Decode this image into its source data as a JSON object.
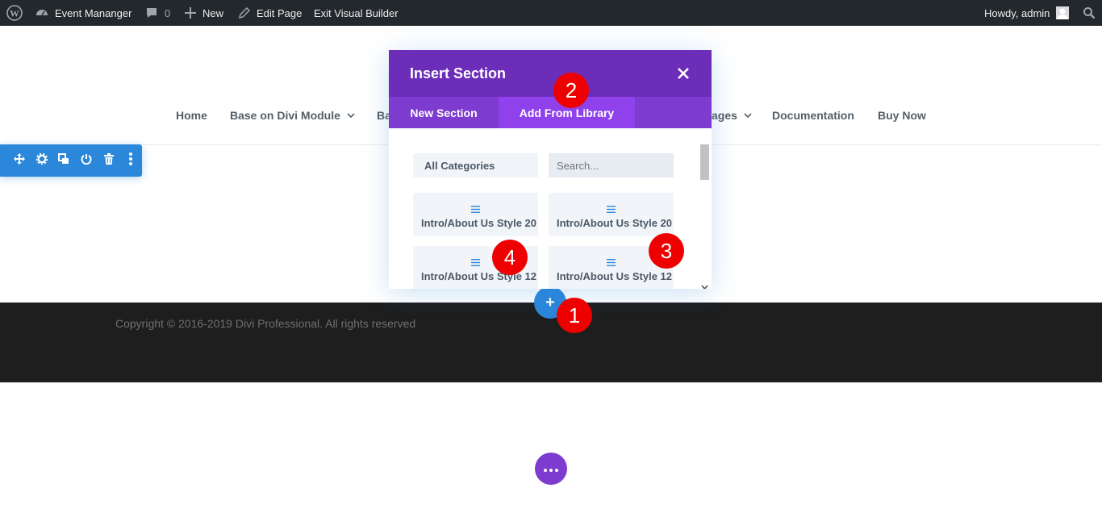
{
  "admin_bar": {
    "site_name": "Event Mananger",
    "comments_count": "0",
    "new_label": "New",
    "edit_page_label": "Edit Page",
    "exit_builder_label": "Exit Visual Builder",
    "howdy_label": "Howdy, admin"
  },
  "nav": {
    "items": [
      {
        "label": "Home"
      },
      {
        "label": "Base on Divi Module",
        "has_dropdown": true
      },
      {
        "label": "Ba"
      },
      {
        "label": "ages",
        "has_dropdown": true
      },
      {
        "label": "Documentation"
      },
      {
        "label": "Buy Now"
      }
    ]
  },
  "section_toolbar": {
    "icons": [
      "move-icon",
      "gear-icon",
      "duplicate-icon",
      "power-icon",
      "trash-icon",
      "more-vertical-icon"
    ]
  },
  "modal": {
    "title": "Insert Section",
    "tabs": [
      {
        "label": "New Section",
        "active": false
      },
      {
        "label": "Add From Library",
        "active": true
      }
    ],
    "category_select": "All Categories",
    "search_placeholder": "Search...",
    "items": [
      {
        "label": "Intro/About Us Style 20"
      },
      {
        "label": "Intro/About Us Style 20"
      },
      {
        "label": "Intro/About Us Style 12"
      },
      {
        "label": "Intro/About Us Style 12"
      }
    ]
  },
  "footer": {
    "copyright": "Copyright © 2016-2019 Divi Professional. All rights reserved"
  },
  "add_section_button": "+",
  "markers": [
    "1",
    "2",
    "3",
    "4"
  ],
  "colors": {
    "admin_bar": "#23282d",
    "modal_header": "#6c2eb9",
    "modal_tabs": "#7e3bd0",
    "active_tab": "#8f42ec",
    "toolbar_blue": "#2b87da",
    "footer_bg": "#1e1e1e",
    "marker_red": "#ee0000"
  }
}
